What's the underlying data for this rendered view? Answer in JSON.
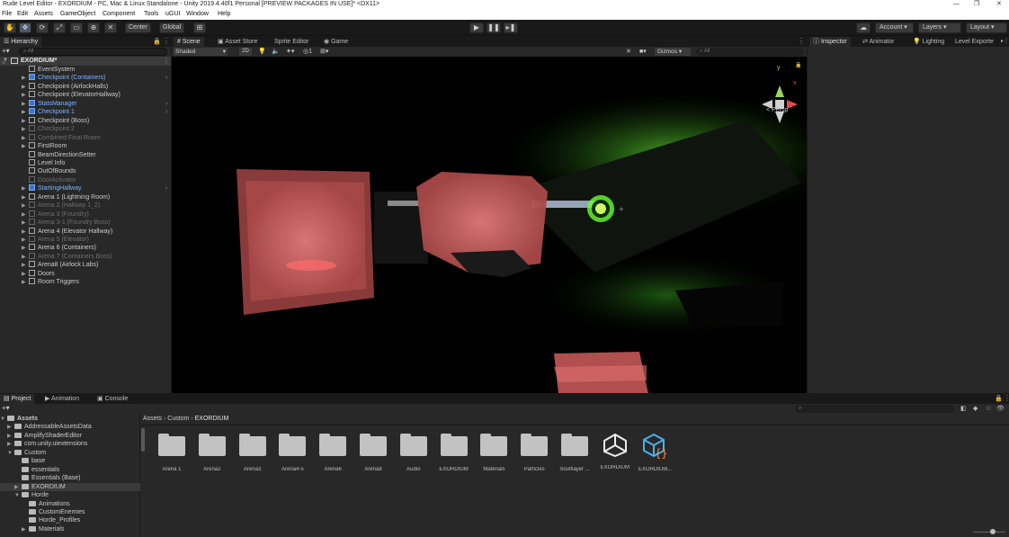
{
  "window": {
    "title": "Rude Level Editor - EXORDIUM - PC, Mac & Linux Standalone - Unity 2019.4.40f1 Personal [PREVIEW PACKAGES IN USE]* <DX11>",
    "min": "—",
    "max": "❐",
    "close": "✕"
  },
  "menu": [
    "File",
    "Edit",
    "Assets",
    "GameObject",
    "Component",
    "Tools",
    "uGUI",
    "Window",
    "Help"
  ],
  "toolbar": {
    "center_label": "Center",
    "global_label": "Global",
    "account_label": "Account",
    "layers_label": "Layers",
    "layout_label": "Layout"
  },
  "hierarchy": {
    "tab": "Hierarchy",
    "search_placeholder": "All",
    "scene": "EXORDIUM*",
    "items": [
      {
        "label": "EventSystem",
        "style": "normal",
        "arrow": ""
      },
      {
        "label": "Checkpoint (Containers)",
        "style": "blue",
        "arrow": "▶"
      },
      {
        "label": "Checkpoint (AirlockHalls)",
        "style": "normal",
        "arrow": "▶"
      },
      {
        "label": "Checkpoint (ElevatorHallway)",
        "style": "normal",
        "arrow": "▶"
      },
      {
        "label": "StatsManager",
        "style": "blue",
        "arrow": "▶"
      },
      {
        "label": "Checkpoint 1",
        "style": "blue",
        "arrow": "▶"
      },
      {
        "label": "Checkpoint (Boss)",
        "style": "normal",
        "arrow": "▶"
      },
      {
        "label": "Checkpoint 2",
        "style": "dim",
        "arrow": "▶"
      },
      {
        "label": "Combined Final Room",
        "style": "dim",
        "arrow": "▶"
      },
      {
        "label": "FirstRoom",
        "style": "normal",
        "arrow": "▶"
      },
      {
        "label": "BeamDirectionSetter",
        "style": "normal",
        "arrow": ""
      },
      {
        "label": "Level Info",
        "style": "normal",
        "arrow": ""
      },
      {
        "label": "OutOfBounds",
        "style": "normal",
        "arrow": ""
      },
      {
        "label": "DoorActivator",
        "style": "dim",
        "arrow": ""
      },
      {
        "label": "StartingHallway",
        "style": "blue",
        "arrow": "▶"
      },
      {
        "label": "Arena 1 (Lightning Room)",
        "style": "normal",
        "arrow": "▶"
      },
      {
        "label": "Arena 2 (Hallway 1_2)",
        "style": "dim",
        "arrow": "▶"
      },
      {
        "label": "Arena 3 (Foundry)",
        "style": "dim",
        "arrow": "▶"
      },
      {
        "label": "Arena 3-1 (Foundry Boss)",
        "style": "dim",
        "arrow": "▶"
      },
      {
        "label": "Arena 4 (Elevator Hallway)",
        "style": "normal",
        "arrow": "▶"
      },
      {
        "label": "Arena 5 (Elevator)",
        "style": "dim",
        "arrow": "▶"
      },
      {
        "label": "Arena 6 (Containers)",
        "style": "normal",
        "arrow": "▶"
      },
      {
        "label": "Arena 7 (Containers Boss)",
        "style": "dim",
        "arrow": "▶"
      },
      {
        "label": "Arena8 (Airlock Labs)",
        "style": "normal",
        "arrow": "▶"
      },
      {
        "label": "Doors",
        "style": "normal",
        "arrow": "▶"
      },
      {
        "label": "Room Triggers",
        "style": "normal",
        "arrow": "▶"
      }
    ]
  },
  "scene_view": {
    "tabs": [
      "Scene",
      "Asset Store",
      "Sprite Editor",
      "Game"
    ],
    "shading": "Shaded",
    "mode_2d": "2D",
    "gizmos": "Gizmos",
    "search_placeholder": "All",
    "persp": "< Persp",
    "layers_count": "1",
    "axis_y": "y",
    "axis_x": "x"
  },
  "right_panel": {
    "tabs": [
      "Inspector",
      "Animator",
      "Lighting",
      "Level Exporte"
    ]
  },
  "project": {
    "tabs": [
      "Project",
      "Animation",
      "Console"
    ],
    "breadcrumb": [
      "Assets",
      "Custom",
      "EXORDIUM"
    ],
    "tree": [
      {
        "label": "Assets",
        "indent": 0,
        "arrow": "▼",
        "bold": true
      },
      {
        "label": "AddressableAssetsData",
        "indent": 1,
        "arrow": "▶"
      },
      {
        "label": "AmplifyShaderEditor",
        "indent": 1,
        "arrow": "▶"
      },
      {
        "label": "com.unity.uiextensions",
        "indent": 1,
        "arrow": "▶"
      },
      {
        "label": "Custom",
        "indent": 1,
        "arrow": "▼"
      },
      {
        "label": "base",
        "indent": 2,
        "arrow": ""
      },
      {
        "label": "essentials",
        "indent": 2,
        "arrow": ""
      },
      {
        "label": "Essentials (Base)",
        "indent": 2,
        "arrow": ""
      },
      {
        "label": "EXORDIUM",
        "indent": 2,
        "arrow": "▶",
        "selected": true
      },
      {
        "label": "Horde",
        "indent": 2,
        "arrow": "▼"
      },
      {
        "label": "Animations",
        "indent": 3,
        "arrow": ""
      },
      {
        "label": "CustomEnemies",
        "indent": 3,
        "arrow": ""
      },
      {
        "label": "Horde_Profiles",
        "indent": 3,
        "arrow": ""
      },
      {
        "label": "Materials",
        "indent": 3,
        "arrow": "▶"
      }
    ],
    "assets": [
      {
        "label": "Arena 1",
        "kind": "folder"
      },
      {
        "label": "Arena2",
        "kind": "folder"
      },
      {
        "label": "Arena3",
        "kind": "folder"
      },
      {
        "label": "Arena4-5",
        "kind": "folder"
      },
      {
        "label": "Arena6",
        "kind": "folder"
      },
      {
        "label": "Arena8",
        "kind": "folder"
      },
      {
        "label": "Audio",
        "kind": "folder"
      },
      {
        "label": "EXORDIUM",
        "kind": "folder"
      },
      {
        "label": "Materials",
        "kind": "folder"
      },
      {
        "label": "Particles",
        "kind": "folder"
      },
      {
        "label": "Soulflayer ...",
        "kind": "folder"
      },
      {
        "label": "EXORDIUM",
        "kind": "unity-scene"
      },
      {
        "label": "EXORDIUM...",
        "kind": "asmdef"
      }
    ],
    "asset_count": "13"
  },
  "colors": {
    "accent": "#4a90e2",
    "blue_text": "#7cb4ff",
    "panel": "#282828",
    "bg": "#191919"
  }
}
